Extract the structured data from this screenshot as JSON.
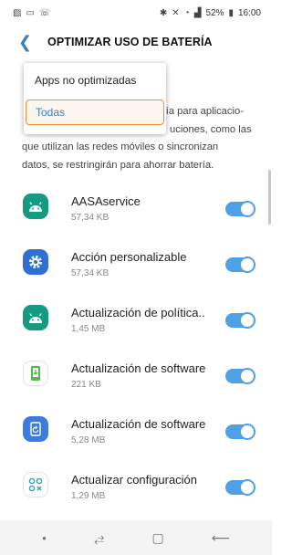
{
  "status_bar": {
    "left_icons": [
      "image-icon",
      "message-icon",
      "missed-call-icon"
    ],
    "right_icons": [
      "bluetooth-icon",
      "mute-icon",
      "wifi-icon",
      "signal-icon"
    ],
    "battery_text": "52%",
    "time": "16:00"
  },
  "header": {
    "title": "OPTIMIZAR USO DE BATERÍA"
  },
  "dropdown": {
    "options": [
      "Apps no optimizadas",
      "Todas"
    ],
    "selected": "Todas"
  },
  "description_lines": [
    "ría para aplicacio-",
    "uciones, como las",
    "que utilizan las redes móviles o sincronizan",
    "datos, se restringirán para ahorrar batería."
  ],
  "apps": [
    {
      "name": "AASAservice",
      "size": "57,34 KB",
      "icon": "android-icon",
      "enabled": true
    },
    {
      "name": "Acción personalizable",
      "size": "57,34 KB",
      "icon": "gear-icon",
      "enabled": true
    },
    {
      "name": "Actualización de política..",
      "size": "1,45 MB",
      "icon": "android-icon",
      "enabled": true
    },
    {
      "name": "Actualización de software",
      "size": "221 KB",
      "icon": "phone-update-icon",
      "enabled": true
    },
    {
      "name": "Actualización de software",
      "size": "5,28 MB",
      "icon": "phone-refresh-icon",
      "enabled": true
    },
    {
      "name": "Actualizar configuración",
      "size": "1,29 MB",
      "icon": "apps-grid-icon",
      "enabled": true
    }
  ],
  "nav": {
    "icons": [
      "dot-icon",
      "recent-apps-icon",
      "home-icon",
      "back-icon"
    ]
  },
  "colors": {
    "accent": "#3b7ec6",
    "toggle_on": "#4ea1e6",
    "highlight_border": "#f28a3a",
    "android_green": "#169b83",
    "gear_blue": "#2f6fd6"
  }
}
